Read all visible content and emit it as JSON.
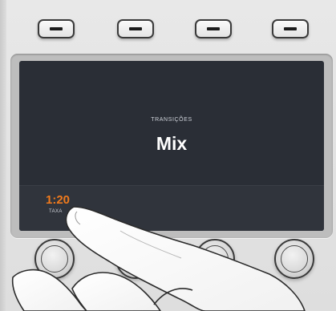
{
  "softkeys": [
    "softkey-1",
    "softkey-2",
    "softkey-3",
    "softkey-4"
  ],
  "lcd": {
    "heading": "TRANSIÇÕES",
    "value": "Mix",
    "rate_value": "1:20",
    "rate_label": "TAXA"
  },
  "knobs": [
    "knob-1",
    "knob-2",
    "knob-3",
    "knob-4"
  ],
  "colors": {
    "panel": "#e3e3e3",
    "lcd_background": "#2a2e36",
    "rate_accent": "#f07a1c"
  }
}
